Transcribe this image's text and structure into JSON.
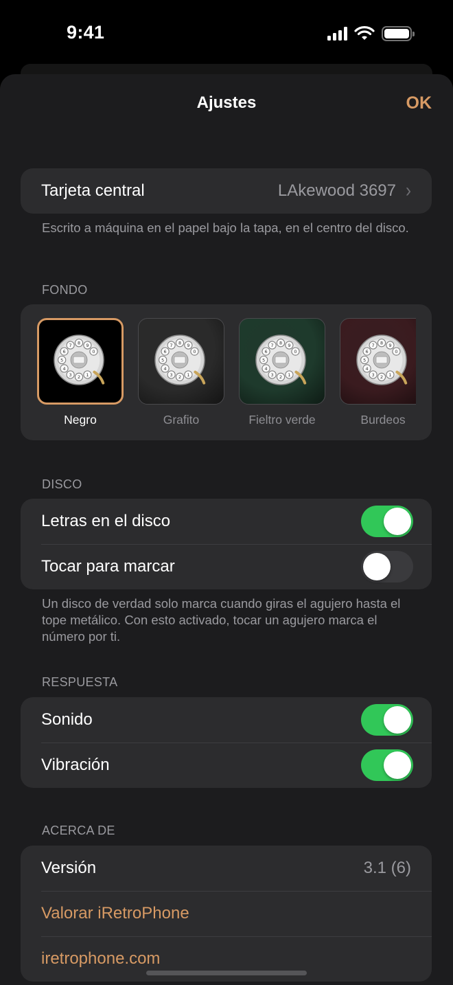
{
  "status": {
    "time": "9:41"
  },
  "nav": {
    "title": "Ajustes",
    "done": "OK"
  },
  "central": {
    "label": "Tarjeta central",
    "value": "LAkewood 3697",
    "footer": "Escrito a máquina en el papel bajo la tapa, en el centro del disco."
  },
  "fondo": {
    "header": "FONDO",
    "options": [
      {
        "label": "Negro",
        "color": "#000000",
        "selected": true
      },
      {
        "label": "Grafito",
        "color": "#2a2a2a",
        "selected": false
      },
      {
        "label": "Fieltro verde",
        "color": "#1e3a2c",
        "selected": false
      },
      {
        "label": "Burdeos",
        "color": "#3a1b1f",
        "selected": false
      }
    ]
  },
  "disco": {
    "header": "DISCO",
    "letters": {
      "label": "Letras en el disco",
      "on": true
    },
    "tap": {
      "label": "Tocar para marcar",
      "on": false
    },
    "footer": "Un disco de verdad solo marca cuando giras el agujero hasta el tope metálico. Con esto activado, tocar un agujero marca el número por ti."
  },
  "respuesta": {
    "header": "RESPUESTA",
    "sound": {
      "label": "Sonido",
      "on": true
    },
    "vibration": {
      "label": "Vibración",
      "on": true
    }
  },
  "about": {
    "header": "ACERCA DE",
    "version_label": "Versión",
    "version_value": "3.1 (6)",
    "rate": "Valorar iRetroPhone",
    "site": "iretrophone.com"
  },
  "colors": {
    "accent": "#d79a64",
    "toggle_on": "#31c758"
  }
}
